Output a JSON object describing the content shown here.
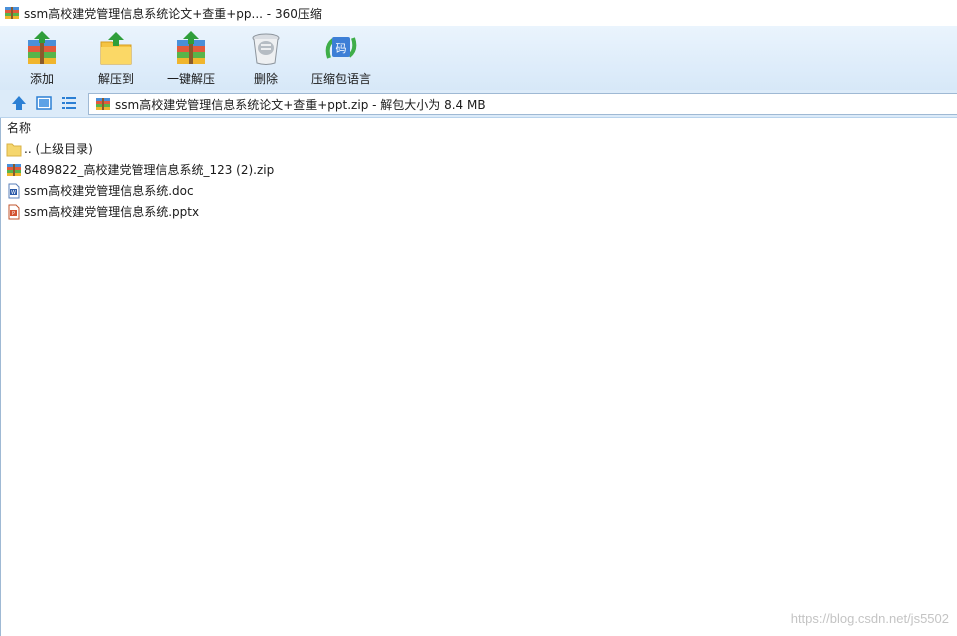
{
  "window": {
    "title": "ssm高校建党管理信息系统论文+查重+pp... - 360压缩"
  },
  "toolbar": {
    "items": [
      {
        "label": "添加",
        "icon": "add-archive-icon"
      },
      {
        "label": "解压到",
        "icon": "extract-to-icon"
      },
      {
        "label": "一键解压",
        "icon": "one-click-extract-icon"
      },
      {
        "label": "删除",
        "icon": "delete-trash-icon"
      },
      {
        "label": "压缩包语言",
        "icon": "archive-language-icon"
      }
    ]
  },
  "navigation": {
    "address": "ssm高校建党管理信息系统论文+查重+ppt.zip - 解包大小为 8.4 MB"
  },
  "filelist": {
    "column_name": "名称",
    "rows": [
      {
        "name": ".. (上级目录)",
        "icon": "folder-up-icon"
      },
      {
        "name": "8489822_高校建党管理信息系统_123 (2).zip",
        "icon": "zip-archive-icon"
      },
      {
        "name": "ssm高校建党管理信息系统.doc",
        "icon": "word-doc-icon"
      },
      {
        "name": "ssm高校建党管理信息系统.pptx",
        "icon": "powerpoint-icon"
      }
    ]
  },
  "watermark": "https://blog.csdn.net/js5502",
  "colors": {
    "toolbar_bg": "#dcebf9",
    "border": "#9fb9d4"
  }
}
